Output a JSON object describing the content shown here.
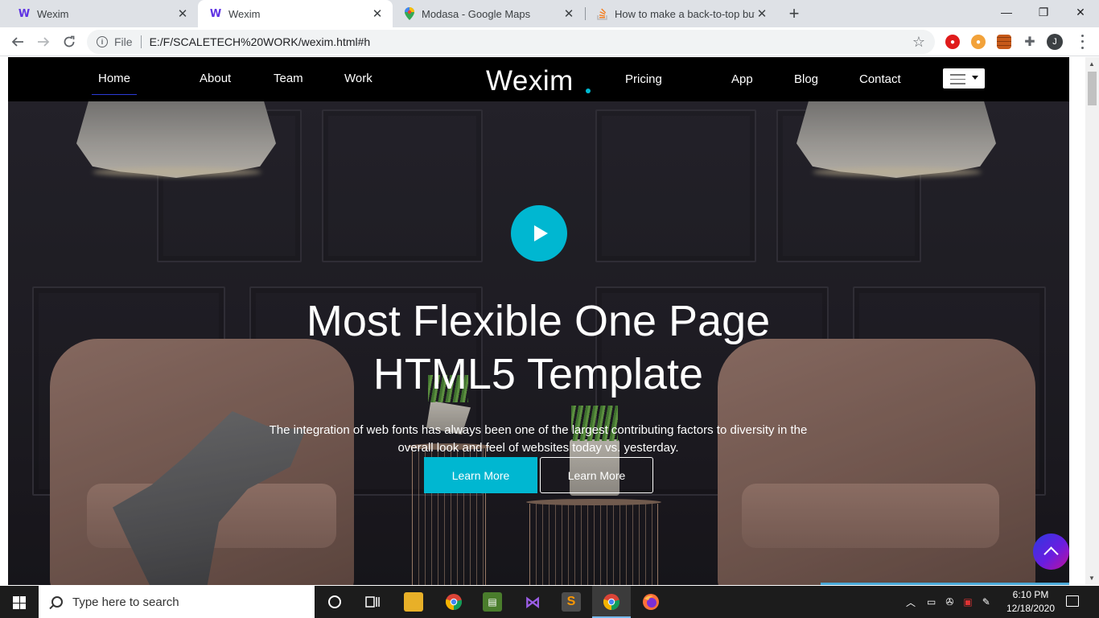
{
  "browser": {
    "tabs": [
      {
        "title": "Wexim",
        "favicon": "wexim-w-icon",
        "active": false
      },
      {
        "title": "Wexim",
        "favicon": "wexim-w-icon",
        "active": true
      },
      {
        "title": "Modasa - Google Maps",
        "favicon": "maps-pin-icon",
        "active": false
      },
      {
        "title": "How to make a back-to-top butt",
        "favicon": "stack-overflow-icon",
        "active": false
      }
    ],
    "close_glyph": "✕",
    "new_tab_glyph": "+",
    "window_controls": {
      "minimize": "—",
      "restore": "❐",
      "close": "✕"
    },
    "address": {
      "scheme_label": "File",
      "url": "E:/F/SCALETECH%20WORK/wexim.html#h"
    },
    "profile_initial": "J"
  },
  "site": {
    "nav_left": [
      "Home",
      "About",
      "Team",
      "Work"
    ],
    "brand": "Wexim",
    "nav_right": [
      "Pricing",
      "App",
      "Blog",
      "Contact"
    ],
    "active_item": "Home"
  },
  "hero": {
    "title_line1": "Most Flexible One Page",
    "title_line2": "HTML5 Template",
    "subtitle_line1": "The integration of web fonts has always been one of the largest contributing factors to diversity in the",
    "subtitle_line2": "overall look and feel of websites today vs. yesterday.",
    "primary_button": "Learn More",
    "secondary_button": "Learn More"
  },
  "colors": {
    "accent": "#00b7d1",
    "nav_bg": "#000000",
    "back_to_top_gradient": [
      "#2b3ae0",
      "#6a1de0",
      "#c0129a"
    ]
  },
  "taskbar": {
    "search_placeholder": "Type here to search",
    "time": "6:10 PM",
    "date": "12/18/2020"
  }
}
